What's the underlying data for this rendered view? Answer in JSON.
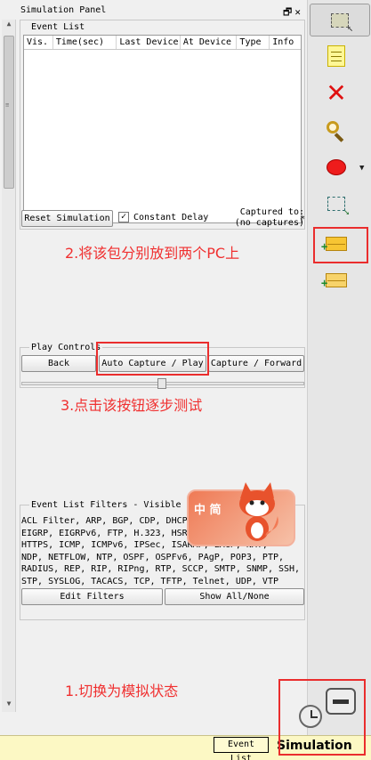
{
  "panel": {
    "title": "Simulation Panel",
    "title_buttons": "🗗✕",
    "event_list_legend": "Event List",
    "columns": [
      "Vis.",
      "Time(sec)",
      "Last Device",
      "At Device",
      "Type",
      "Info"
    ],
    "reset_button": "Reset Simulation",
    "constant_delay_label": "Constant Delay",
    "constant_delay_checked": "✓",
    "captured_line1": "Captured to:",
    "captured_line2": "(no captures)",
    "captured_asterisk": "*"
  },
  "play_controls": {
    "legend": "Play Controls",
    "back_button": "Back",
    "auto_capture_button": "Auto Capture / Play",
    "capture_forward_button": "Capture / Forward"
  },
  "filters": {
    "legend": "Event List Filters - Visible Events",
    "lines": [
      "ACL Filter, ARP, BGP, CDP, DHCP, DHCPv6, DNS, DTP,",
      "EIGRP, EIGRPv6, FTP, H.323, HSRP, HSRPv6, HTTP,",
      "HTTPS, ICMP, ICMPv6, IPSec, ISAKMP, LACP, NAT,",
      "NDP, NETFLOW, NTP, OSPF, OSPFv6, PAgP, POP3, PTP,",
      "RADIUS, REP, RIP, RIPng, RTP, SCCP, SMTP, SNMP, SSH,",
      "STP, SYSLOG, TACACS, TCP, TFTP, Telnet, UDP, VTP"
    ],
    "edit_button": "Edit Filters",
    "show_all_button": "Show All/None"
  },
  "statusbar": {
    "event_list_button": "Event List",
    "simulation_label": "Simulation"
  },
  "annotations": {
    "step1": "1.切换为模拟状态",
    "step2": "2.将该包分别放到两个PC上",
    "step3": "3.点击该按钮逐步测试"
  },
  "sticker": {
    "text": "中 简"
  },
  "colors": {
    "annotation_red": "#f03030",
    "statusbar_yellow": "#fcf8c4"
  },
  "toolbar_icons": [
    "select-icon",
    "note-icon",
    "delete-icon",
    "inspect-icon",
    "draw-ellipse-icon",
    "resize-icon",
    "add-simple-pdu-icon",
    "add-complex-pdu-icon"
  ]
}
